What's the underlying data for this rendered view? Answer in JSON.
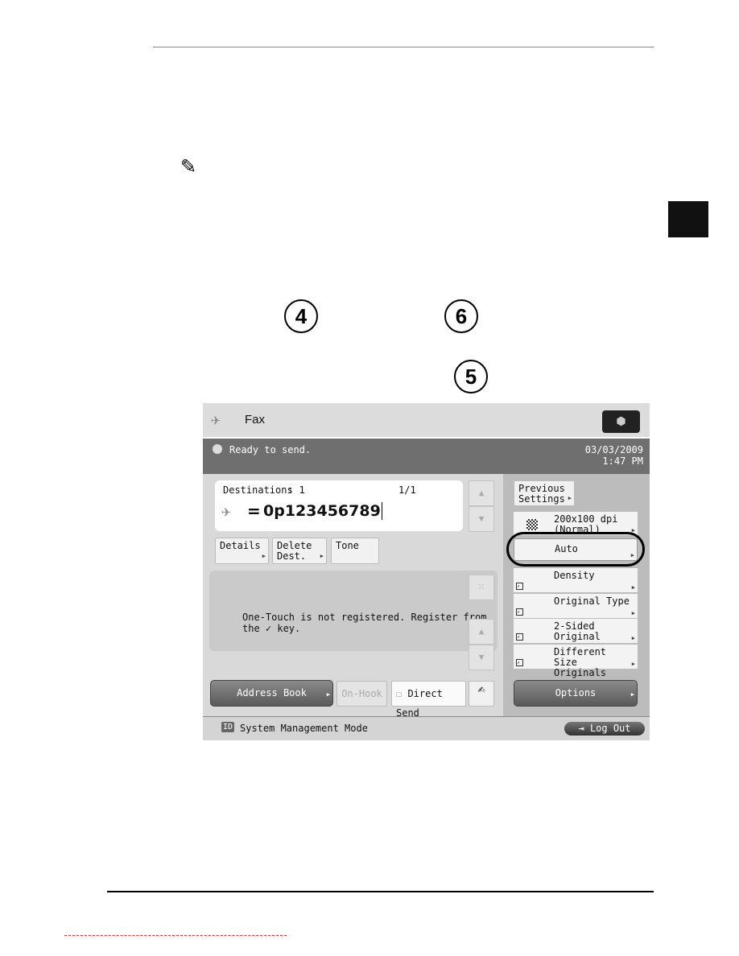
{
  "callouts": [
    "4",
    "6",
    "5"
  ],
  "fax_ui": {
    "title": "Fax",
    "status": "Ready to send.",
    "date": "03/03/2009",
    "time": "1:47 PM",
    "destinations_label": "Destinations",
    "destinations_count": ": 1",
    "page_indicator": "1/1",
    "number_prefix": "=",
    "number": "0p123456789",
    "buttons": {
      "details": "Details",
      "delete": "Delete Dest.",
      "tone": "Tone",
      "address_book": "Address Book",
      "on_hook": "On-Hook",
      "direct_send": "Direct Send",
      "options": "Options",
      "log_out": "Log Out",
      "previous_settings": "Previous Settings"
    },
    "one_touch_message_1": "One-Touch is not registered. Register from",
    "one_touch_message_2": "the ✓ key.",
    "settings": [
      {
        "label": "200x100 dpi (Normal)"
      },
      {
        "label": "Auto"
      },
      {
        "label": "Density"
      },
      {
        "label": "Original Type"
      },
      {
        "label": "2-Sided Original"
      },
      {
        "label": "Different Size Originals"
      }
    ],
    "footer_mode": "System Management Mode",
    "footer_id_badge": "ID"
  }
}
